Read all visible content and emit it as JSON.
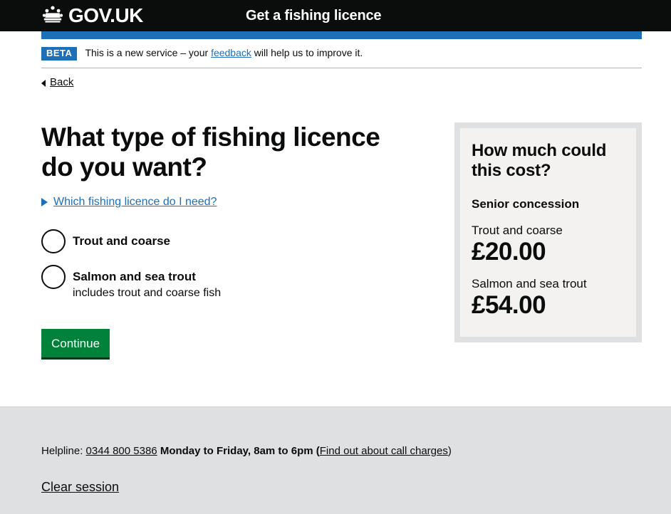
{
  "header": {
    "logo_text": "GOV.UK",
    "logo_icon": "crown-icon",
    "service_name": "Get a fishing licence"
  },
  "phase_banner": {
    "tag": "BETA",
    "text_before": "This is a new service – your ",
    "link": "feedback",
    "text_after": " will help us to improve it."
  },
  "back": {
    "label": "Back",
    "icon": "triangle-left-icon"
  },
  "main": {
    "heading": "What type of fishing licence do you want?",
    "details": {
      "icon": "triangle-right-icon",
      "summary": "Which fishing licence do I need?"
    },
    "radios": [
      {
        "label": "Trout and coarse",
        "hint": "",
        "selected": false
      },
      {
        "label": "Salmon and sea trout",
        "hint": "includes trout and coarse fish",
        "selected": false
      }
    ],
    "continue_label": "Continue"
  },
  "sidebar": {
    "title": "How much could this cost?",
    "subtitle": "Senior concession",
    "items": [
      {
        "label": "Trout and coarse",
        "price": "£20.00"
      },
      {
        "label": "Salmon and sea trout",
        "price": "£54.00"
      }
    ]
  },
  "footer": {
    "helpline_prefix": "Helpline: ",
    "phone": "0344 800 5386",
    "hours": " Monday to Friday, 8am to 6pm (",
    "call_charges_link": "Find out about call charges",
    "paren_close": ")",
    "clear_session": "Clear session"
  },
  "colors": {
    "black": "#0b0c0c",
    "blue": "#1d70b8",
    "green": "#00823b",
    "grey_panel": "#f3f2f1",
    "grey_border": "#dee0e2"
  }
}
